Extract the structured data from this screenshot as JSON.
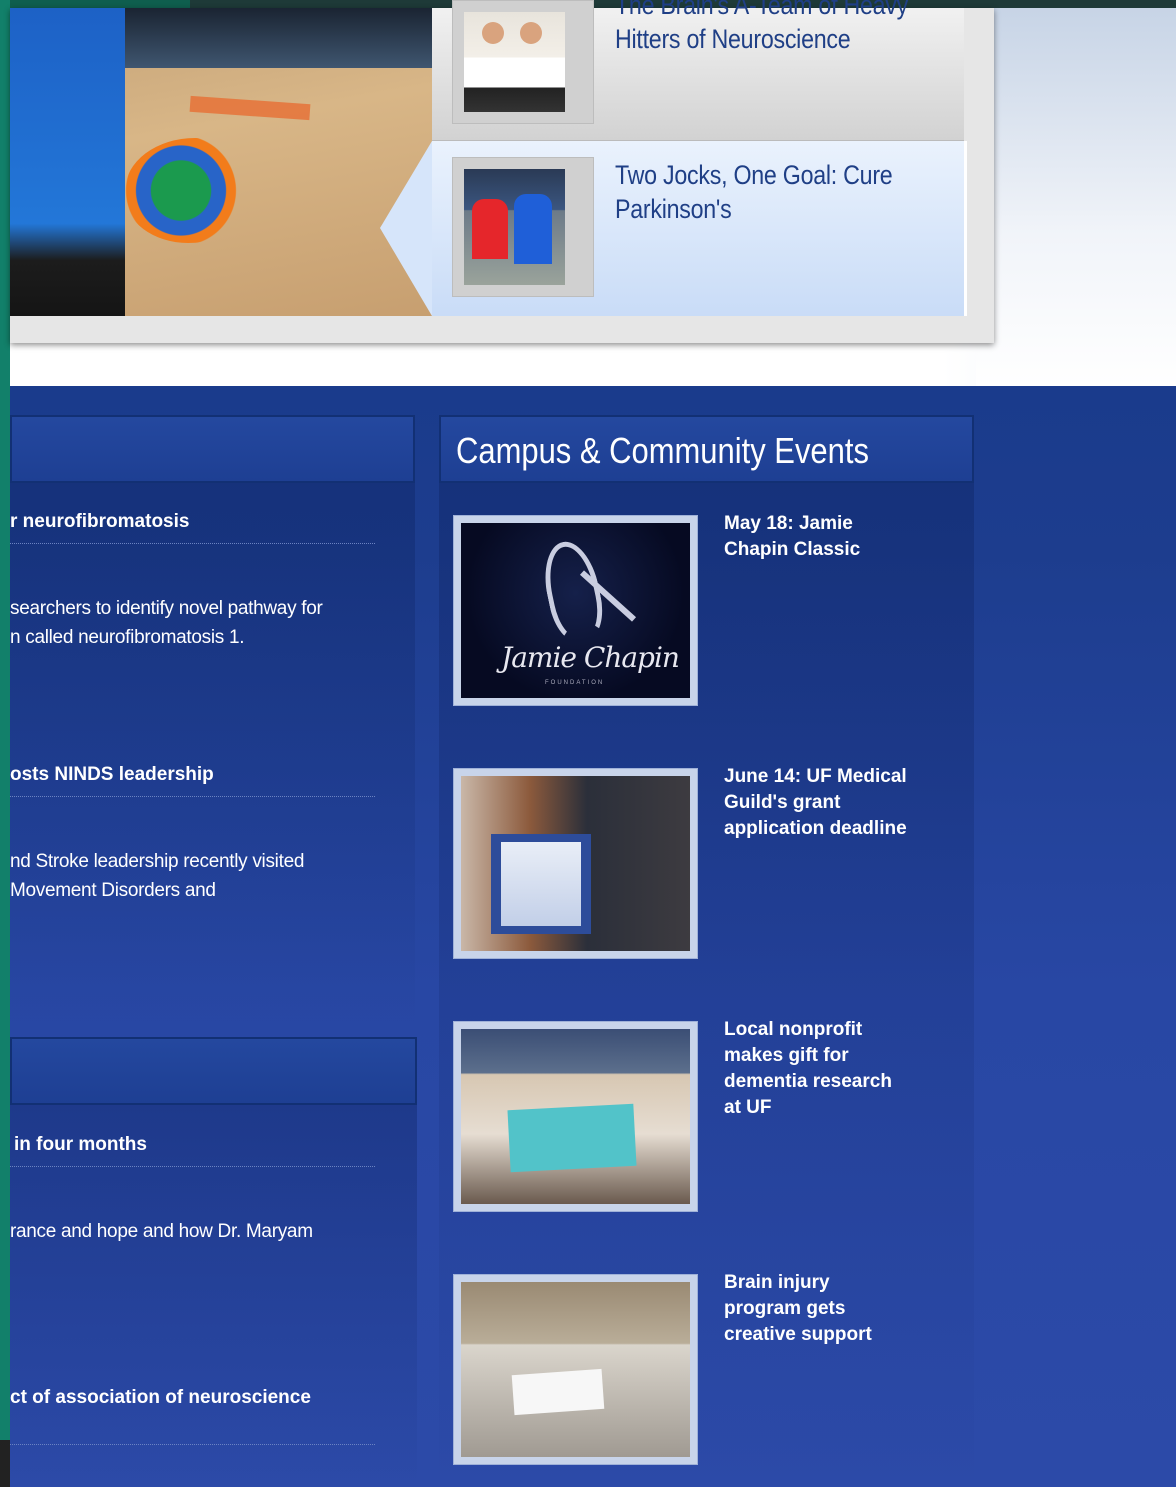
{
  "featured_stories": [
    {
      "title": "The Brain's A-Team of\nHeavy Hitters of\nNeuroscience"
    },
    {
      "title": "Two Jocks, One Goal: Cure\nParkinson's"
    }
  ],
  "news_panel": {
    "items": [
      {
        "title": "r neurofibromatosis",
        "text": "searchers to identify novel pathway for\nn called neurofibromatosis 1."
      },
      {
        "title": "osts NINDS leadership",
        "text": "nd Stroke leadership recently visited\nMovement Disorders and"
      }
    ]
  },
  "news_panel_2": {
    "items": [
      {
        "title": "in four months",
        "text": "rance and hope and how Dr. Maryam"
      },
      {
        "title": "ct of association of neuroscience",
        "text": ""
      }
    ]
  },
  "events": {
    "heading": "Campus & Community Events",
    "items": [
      {
        "title": "May 18: Jamie\nChapin Classic",
        "image_text": "Jamie Chapin",
        "image_subtext": "FOUNDATION"
      },
      {
        "title": "June 14: UF Medical\nGuild's grant\napplication deadline"
      },
      {
        "title": "Local nonprofit\nmakes gift for\ndementia research\nat UF"
      },
      {
        "title": "Brain injury\nprogram gets\ncreative support"
      }
    ]
  }
}
